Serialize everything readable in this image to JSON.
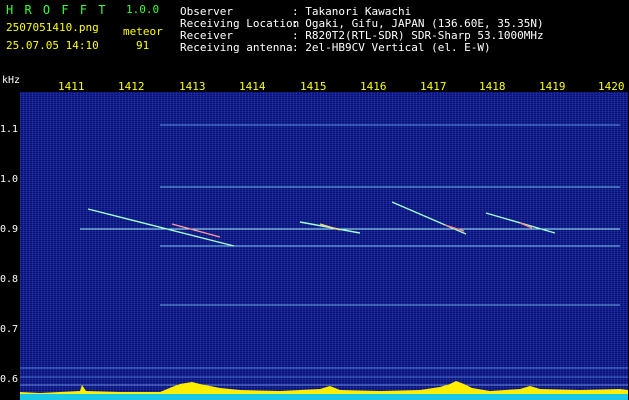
{
  "app": {
    "name": "H R O F F T",
    "version": "1.0.0",
    "filename": "2507051410.png",
    "datetime": "25.07.05 14:10",
    "mode": "meteor",
    "count": "91"
  },
  "info": {
    "labels": [
      "Observer",
      "Receiving Location",
      "Receiver",
      "Receiving antenna"
    ],
    "values": [
      ": Takanori Kawachi",
      ": Ogaki, Gifu, JAPAN (136.60E, 35.35N)",
      ": R820T2(RTL-SDR) SDR-Sharp 53.1000MHz",
      ": 2el-HB9CV Vertical (el. E-W)"
    ]
  },
  "axes": {
    "y_unit": "kHz",
    "x_ticks": [
      "1411",
      "1412",
      "1413",
      "1414",
      "1415",
      "1416",
      "1417",
      "1418",
      "1419",
      "1420"
    ],
    "y_ticks": [
      "1.1",
      "1.0",
      "0.9",
      "0.8",
      "0.7",
      "0.6"
    ]
  },
  "colors": {
    "background": "#08107a",
    "carrier": "#7fe0ff",
    "meteor_echo": "#a0ffd0",
    "amplitude": "#ffee00",
    "axis_text": "#ffff00"
  }
}
